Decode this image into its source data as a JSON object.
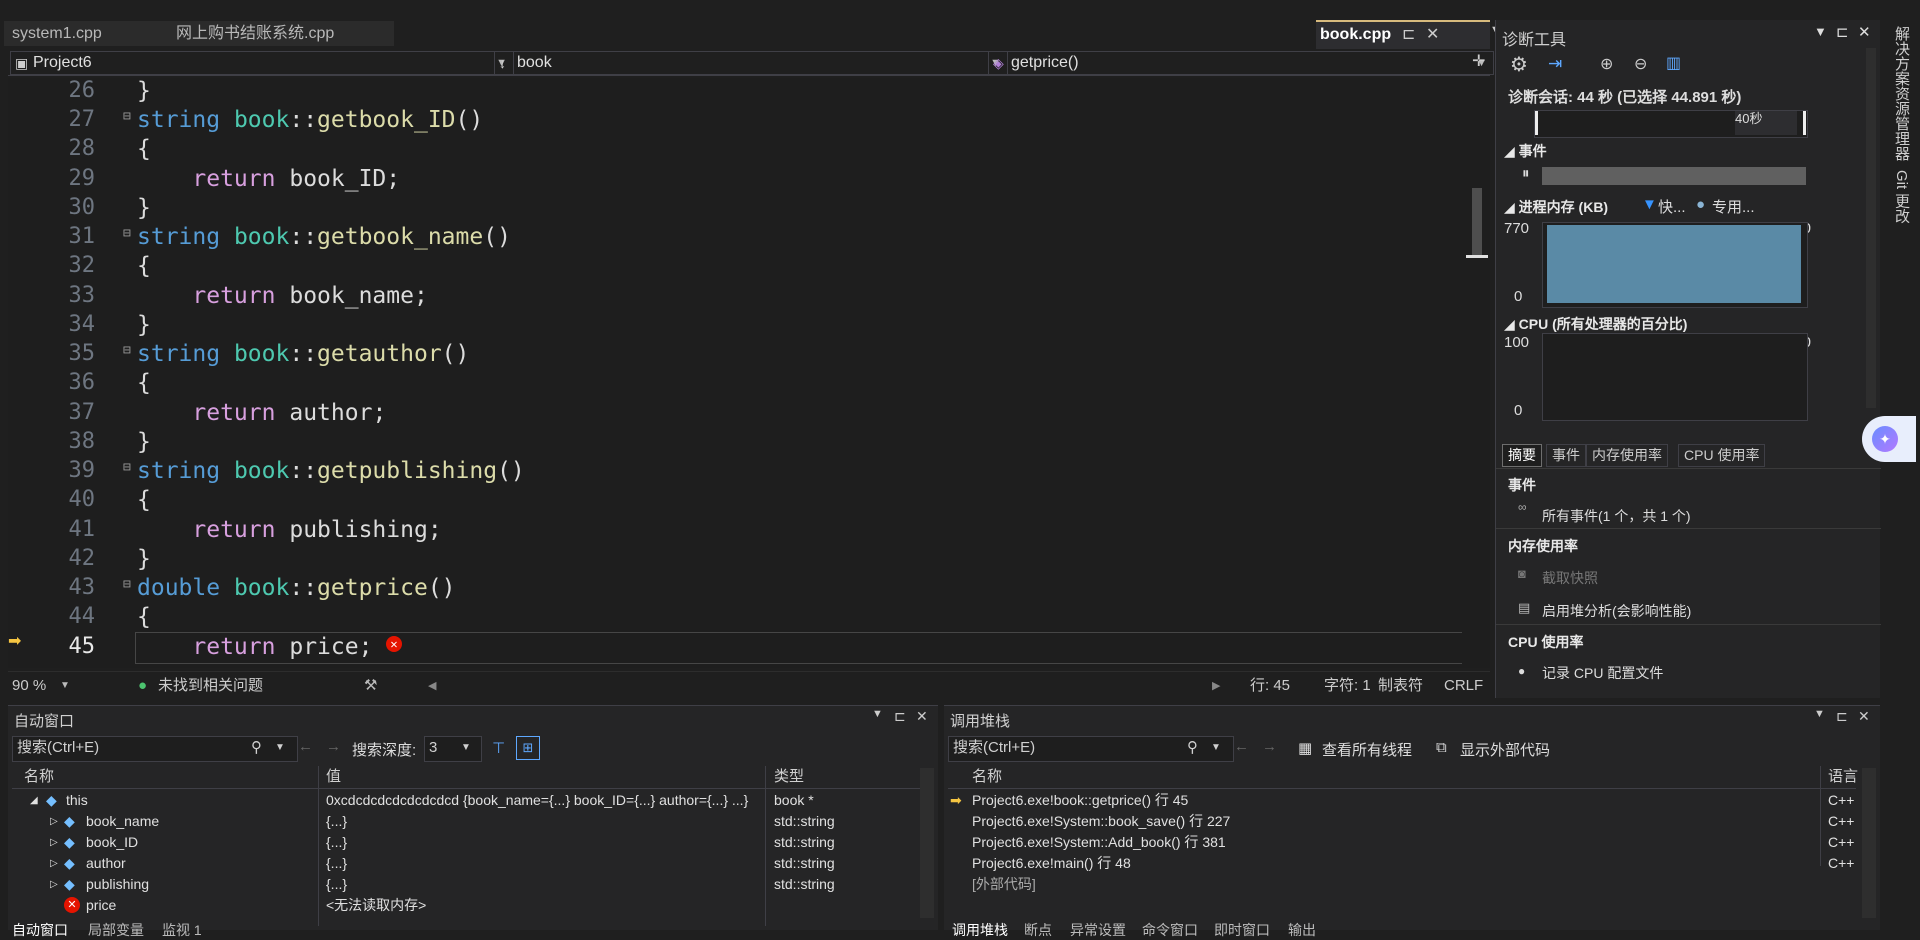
{
  "file_tabs": [
    {
      "label": "system1.cpp"
    },
    {
      "label": "网上购书结账系统.cpp"
    }
  ],
  "active_tab": {
    "label": "book.cpp"
  },
  "navbar": {
    "project": "Project6",
    "scope": "book",
    "member": "getprice()"
  },
  "editor": {
    "lines": [
      {
        "num": "26"
      },
      {
        "num": "27"
      },
      {
        "num": "28"
      },
      {
        "num": "29"
      },
      {
        "num": "30"
      },
      {
        "num": "31"
      },
      {
        "num": "32"
      },
      {
        "num": "33"
      },
      {
        "num": "34"
      },
      {
        "num": "35"
      },
      {
        "num": "36"
      },
      {
        "num": "37"
      },
      {
        "num": "38"
      },
      {
        "num": "39"
      },
      {
        "num": "40"
      },
      {
        "num": "41"
      },
      {
        "num": "42"
      },
      {
        "num": "43"
      },
      {
        "num": "44"
      },
      {
        "num": "45"
      }
    ],
    "tok": {
      "close": "}",
      "open": "{",
      "string": "string",
      "double": "double",
      "book": "book",
      "scope": "::",
      "parens": "()",
      "ret": "return",
      "semi": ";",
      "f27": "getbook_ID",
      "f31": "getbook_name",
      "f35": "getauthor",
      "f39": "getpublishing",
      "f43": "getprice",
      "v29": "book_ID",
      "v33": "book_name",
      "v37": "author",
      "v41": "publishing",
      "v45": "price"
    }
  },
  "statusbar": {
    "zoom": "90 %",
    "issues": "未找到相关问题",
    "line": "行: 45",
    "char": "字符: 1",
    "tabs": "制表符",
    "eol": "CRLF"
  },
  "diagnostics": {
    "title": "诊断工具",
    "session": "诊断会话: 44 秒 (已选择 44.891 秒)",
    "timeline_label": "40秒",
    "events_section": "事件",
    "memory_section": "进程内存 (KB)",
    "legend_snapshot": "快...",
    "legend_private": "专用...",
    "mem_max": "770",
    "mem_min": "0",
    "cpu_section": "CPU (所有处理器的百分比)",
    "cpu_max": "100",
    "cpu_min": "0",
    "tabs": [
      "摘要",
      "事件",
      "内存使用率",
      "CPU 使用率"
    ],
    "summary": {
      "events_heading": "事件",
      "all_events": "所有事件(1 个，共 1 个)",
      "memory_heading": "内存使用率",
      "snapshot": "截取快照",
      "heap": "启用堆分析(会影响性能)",
      "cpu_heading": "CPU 使用率",
      "record_cpu": "记录 CPU 配置文件"
    },
    "colors": {
      "memory_fill": "#5a8aa6",
      "snapshot_marker": "#3794ff"
    }
  },
  "right_strip": {
    "solution_explorer": "解决方案资源管理器",
    "git_changes": "Git 更改"
  },
  "autos": {
    "title": "自动窗口",
    "search_placeholder": "搜索(Ctrl+E)",
    "depth_label": "搜索深度:",
    "depth_value": "3",
    "columns": [
      "名称",
      "值",
      "类型"
    ],
    "rows": [
      {
        "name": "this",
        "value": "0xcdcdcdcdcdcdcdcd {book_name={...} book_ID={...} author={...} ...}",
        "type": "book *"
      },
      {
        "name": "book_name",
        "value": "{...}",
        "type": "std::string"
      },
      {
        "name": "book_ID",
        "value": "{...}",
        "type": "std::string"
      },
      {
        "name": "author",
        "value": "{...}",
        "type": "std::string"
      },
      {
        "name": "publishing",
        "value": "{...}",
        "type": "std::string"
      },
      {
        "name": "price",
        "value": "<无法读取内存>",
        "type": ""
      }
    ],
    "bottom_tabs": [
      "自动窗口",
      "局部变量",
      "监视 1"
    ]
  },
  "callstack": {
    "title": "调用堆栈",
    "search_placeholder": "搜索(Ctrl+E)",
    "view_threads": "查看所有线程",
    "show_external": "显示外部代码",
    "columns": [
      "名称",
      "语言"
    ],
    "rows": [
      {
        "name": "Project6.exe!book::getprice() 行 45",
        "lang": "C++"
      },
      {
        "name": "Project6.exe!System::book_save() 行 227",
        "lang": "C++"
      },
      {
        "name": "Project6.exe!System::Add_book() 行 381",
        "lang": "C++"
      },
      {
        "name": "Project6.exe!main() 行 48",
        "lang": "C++"
      },
      {
        "name": "[外部代码]",
        "lang": ""
      }
    ],
    "bottom_tabs": [
      "调用堆栈",
      "断点",
      "异常设置",
      "命令窗口",
      "即时窗口",
      "输出"
    ]
  }
}
